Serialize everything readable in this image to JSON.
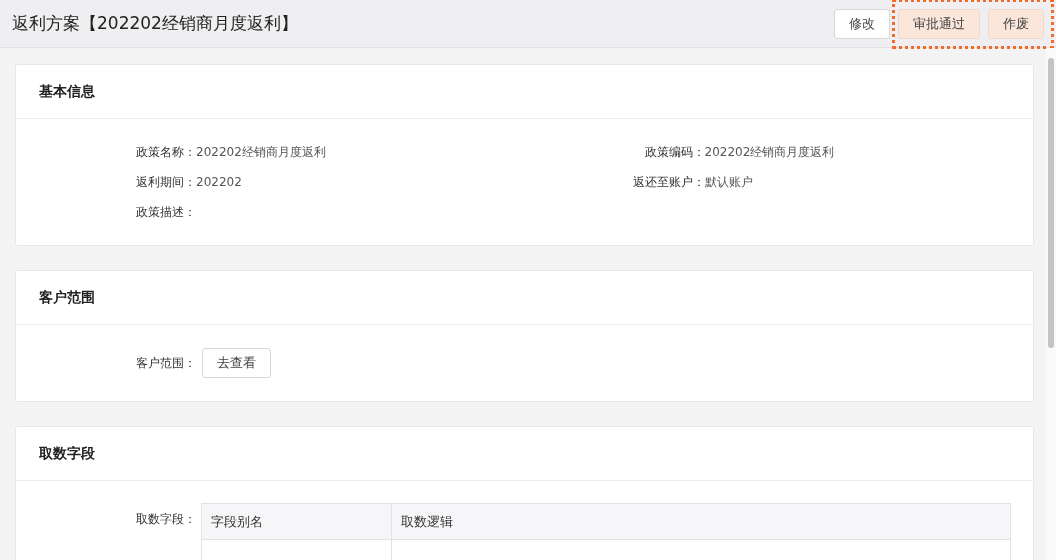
{
  "header": {
    "title": "返利方案【202202经销商月度返利】",
    "buttons": [
      {
        "label": "修改",
        "highlighted": false
      },
      {
        "label": "审批通过",
        "highlighted": true
      },
      {
        "label": "作废",
        "highlighted": true
      }
    ]
  },
  "basic_info": {
    "title": "基本信息",
    "fields": [
      {
        "label": "政策名称：",
        "value": "202202经销商月度返利"
      },
      {
        "label": "政策编码：",
        "value": "202202经销商月度返利"
      },
      {
        "label": "返利期间：",
        "value": "202202"
      },
      {
        "label": "返还至账户：",
        "value": "默认账户"
      },
      {
        "label": "政策描述："
      }
    ]
  },
  "customer_scope": {
    "title": "客户范围",
    "label": "客户范围：",
    "button": "去查看"
  },
  "data_fields": {
    "title": "取数字段",
    "label": "取数字段：",
    "table": {
      "columns": [
        "字段别名",
        "取数逻辑"
      ]
    }
  }
}
